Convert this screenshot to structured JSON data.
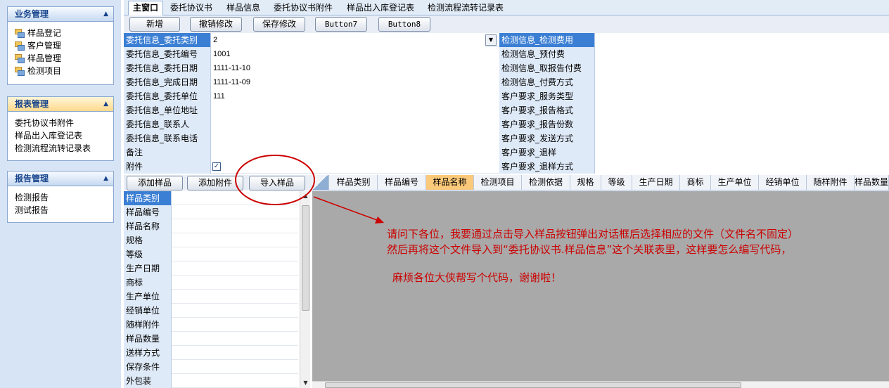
{
  "sidebar": {
    "groups": [
      {
        "title": "业务管理",
        "items": [
          "样品登记",
          "客户管理",
          "样品管理",
          "检测项目"
        ]
      },
      {
        "title": "报表管理",
        "items": [
          "委托协议书附件",
          "样品出入库登记表",
          "检测流程流转记录表"
        ]
      },
      {
        "title": "报告管理",
        "items": [
          "检测报告",
          "测试报告"
        ]
      }
    ]
  },
  "tabs": [
    "主窗口",
    "委托协议书",
    "样品信息",
    "委托协议书附件",
    "样品出入库登记表",
    "检测流程流转记录表"
  ],
  "toolbar": {
    "buttons": [
      "新增",
      "撤销修改",
      "保存修改",
      "Button7",
      "Button8"
    ]
  },
  "form": {
    "left_labels": [
      "委托信息_委托类别",
      "委托信息_委托编号",
      "委托信息_委托日期",
      "委托信息_完成日期",
      "委托信息_委托单位",
      "委托信息_单位地址",
      "委托信息_联系人",
      "委托信息_联系电话",
      "备注",
      "附件"
    ],
    "left_values": [
      "2",
      "1001",
      "1111-11-10",
      "1111-11-09",
      "111",
      "",
      "",
      "",
      "",
      ""
    ],
    "right_labels": [
      "检测信息_检测费用",
      "检测信息_预付费",
      "检测信息_取报告付费",
      "检测信息_付费方式",
      "客户要求_服务类型",
      "客户要求_报告格式",
      "客户要求_报告份数",
      "客户要求_发送方式",
      "客户要求_退样",
      "客户要求_退样方式"
    ]
  },
  "lower_buttons": [
    "添加样品",
    "添加附件",
    "导入样品"
  ],
  "grid_columns": [
    "样品类别",
    "样品编号",
    "样品名称",
    "检测项目",
    "检测依据",
    "规格",
    "等级",
    "生产日期",
    "商标",
    "生产单位",
    "经销单位",
    "随样附件",
    "样品数量"
  ],
  "side_fields": [
    "样品类别",
    "样品编号",
    "样品名称",
    "规格",
    "等级",
    "生产日期",
    "商标",
    "生产单位",
    "经销单位",
    "随样附件",
    "样品数量",
    "送样方式",
    "保存条件",
    "外包装"
  ],
  "annotation": {
    "line1": "请问下各位，我要通过点击导入样品按钮弹出对话框后选择相应的文件（文件名不固定）",
    "line2": "然后再将这个文件导入到“委托协议书.样品信息”这个关联表里，这样要怎么编写代码，",
    "line3": "麻烦各位大侠帮写个代码，谢谢啦！",
    "color": "#cc0000"
  }
}
